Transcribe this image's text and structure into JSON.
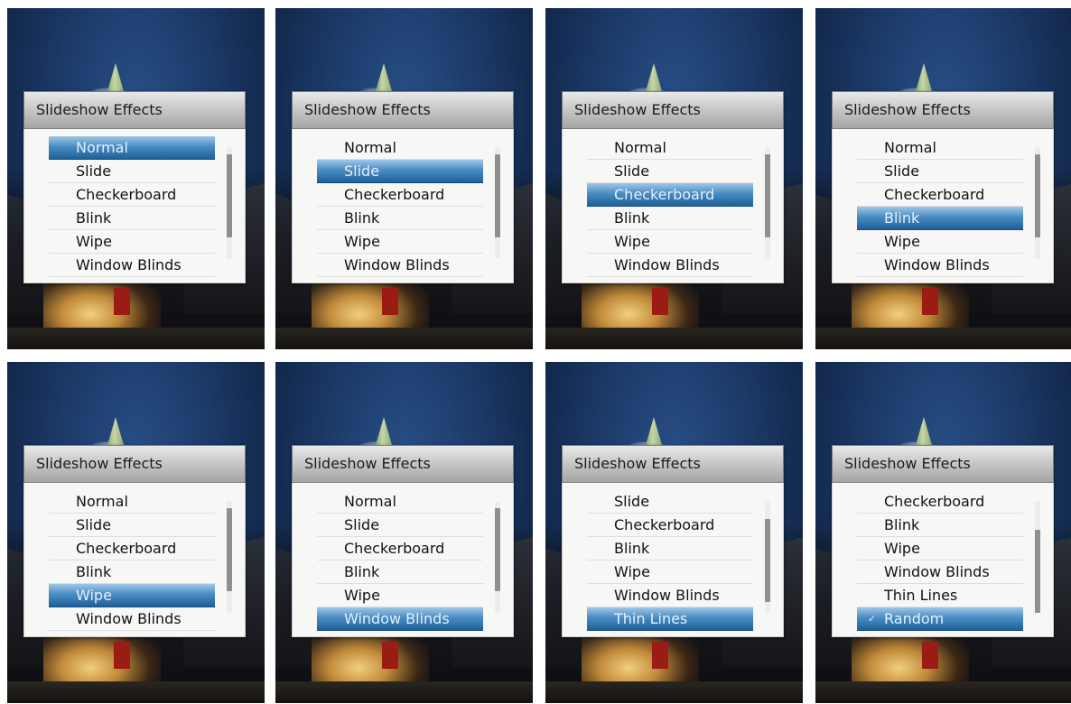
{
  "dialog_title": "Slideshow Effects",
  "colors": {
    "selection_top": "#9fc7e6",
    "selection_bottom": "#1f5f99",
    "title_bar": "#c9c9c9",
    "list_bg": "#f7f7f5"
  },
  "panels": [
    {
      "items": [
        "Normal",
        "Slide",
        "Checkerboard",
        "Blink",
        "Wipe",
        "Window Blinds"
      ],
      "selected_index": 0,
      "checked_index": null
    },
    {
      "items": [
        "Normal",
        "Slide",
        "Checkerboard",
        "Blink",
        "Wipe",
        "Window Blinds"
      ],
      "selected_index": 1,
      "checked_index": null
    },
    {
      "items": [
        "Normal",
        "Slide",
        "Checkerboard",
        "Blink",
        "Wipe",
        "Window Blinds"
      ],
      "selected_index": 2,
      "checked_index": null
    },
    {
      "items": [
        "Normal",
        "Slide",
        "Checkerboard",
        "Blink",
        "Wipe",
        "Window Blinds"
      ],
      "selected_index": 3,
      "checked_index": null
    },
    {
      "items": [
        "Normal",
        "Slide",
        "Checkerboard",
        "Blink",
        "Wipe",
        "Window Blinds"
      ],
      "selected_index": 4,
      "checked_index": null
    },
    {
      "items": [
        "Normal",
        "Slide",
        "Checkerboard",
        "Blink",
        "Wipe",
        "Window Blinds"
      ],
      "selected_index": 5,
      "checked_index": null
    },
    {
      "items": [
        "Slide",
        "Checkerboard",
        "Blink",
        "Wipe",
        "Window Blinds",
        "Thin Lines"
      ],
      "selected_index": 5,
      "checked_index": null
    },
    {
      "items": [
        "Checkerboard",
        "Blink",
        "Wipe",
        "Window Blinds",
        "Thin Lines",
        "Random"
      ],
      "selected_index": 5,
      "checked_index": 5
    }
  ],
  "check_glyph": "✓"
}
